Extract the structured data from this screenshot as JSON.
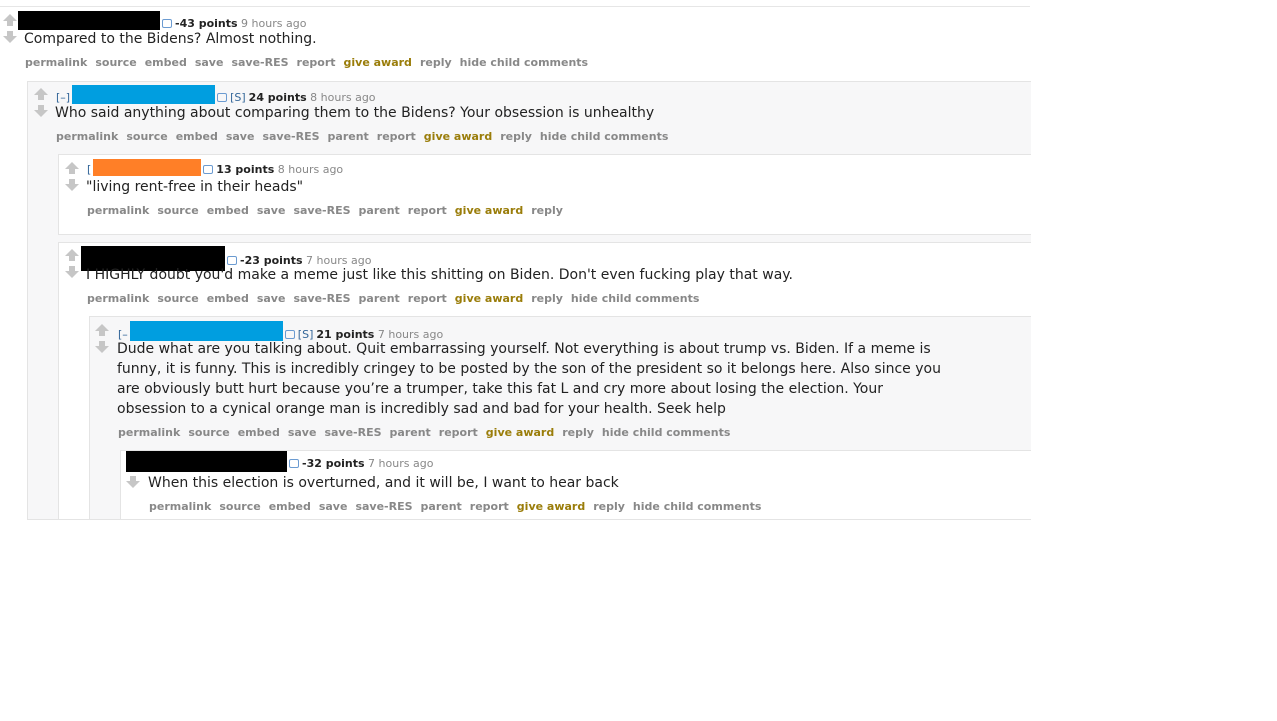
{
  "comments": {
    "c1": {
      "points": "-43 points",
      "time": "9 hours ago",
      "body": "Compared to the Bidens? Almost nothing.",
      "buttons": [
        "permalink",
        "source",
        "embed",
        "save",
        "save-RES",
        "report",
        "give award",
        "reply",
        "hide child comments"
      ]
    },
    "c2": {
      "collapse": "[–]",
      "flag": "[S]",
      "points": "24 points",
      "time": "8 hours ago",
      "body": "Who said anything about comparing them to the Bidens? Your obsession is unhealthy",
      "buttons": [
        "permalink",
        "source",
        "embed",
        "save",
        "save-RES",
        "parent",
        "report",
        "give award",
        "reply",
        "hide child comments"
      ]
    },
    "c3": {
      "collapse": "[",
      "points": "13 points",
      "time": "8 hours ago",
      "body": "\"living rent-free in their heads\"",
      "buttons": [
        "permalink",
        "source",
        "embed",
        "save",
        "save-RES",
        "parent",
        "report",
        "give award",
        "reply"
      ]
    },
    "c4": {
      "points": "-23 points",
      "time": "7 hours ago",
      "body": "I HIGHLY doubt you'd make a meme just like this shitting on Biden. Don't even fucking play that way.",
      "buttons": [
        "permalink",
        "source",
        "embed",
        "save",
        "save-RES",
        "parent",
        "report",
        "give award",
        "reply",
        "hide child comments"
      ]
    },
    "c5": {
      "collapse": "[–",
      "flag": "[S]",
      "points": "21 points",
      "time": "7 hours ago",
      "body": "Dude what are you talking about. Quit embarrassing yourself. Not everything is about trump vs. Biden. If a meme is\nfunny, it is funny. This is incredibly cringey to be posted by the son of the president so it belongs here. Also since you\nare obviously butt hurt because you’re a trumper, take this fat L and cry more about losing the election. Your\nobsession to a cynical orange man is incredibly sad and bad for your health. Seek help",
      "buttons": [
        "permalink",
        "source",
        "embed",
        "save",
        "save-RES",
        "parent",
        "report",
        "give award",
        "reply",
        "hide child comments"
      ]
    },
    "c6": {
      "points": "-32 points",
      "time": "7 hours ago",
      "body": "When this election is overturned, and it will be, I want to hear back",
      "buttons": [
        "permalink",
        "source",
        "embed",
        "save",
        "save-RES",
        "parent",
        "report",
        "give award",
        "reply",
        "hide child comments"
      ]
    }
  },
  "colors": {
    "redact_black": "#000000",
    "redact_blue": "#009ee0",
    "redact_orange": "#ff7f27",
    "award": "#9a7d0a",
    "button_gray": "#888888"
  }
}
